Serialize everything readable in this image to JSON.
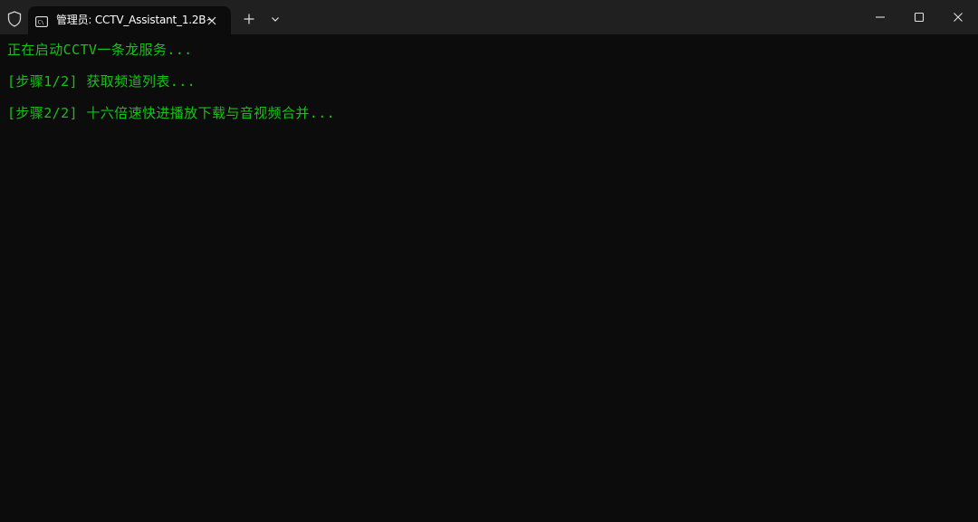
{
  "titlebar": {
    "tab_title": "管理员:  CCTV_Assistant_1.2B~",
    "icons": {
      "shield": "shield-icon",
      "terminal": "terminal-icon",
      "tab_close": "close-icon",
      "new_tab": "plus-icon",
      "dropdown": "chevron-down-icon",
      "minimize": "minimize-icon",
      "maximize": "maximize-icon",
      "close": "close-icon"
    }
  },
  "console": {
    "lines": [
      "正在启动CCTV一条龙服务...",
      "[步骤1/2] 获取频道列表...",
      "[步骤2/2] 十六倍速快进播放下载与音视频合并..."
    ]
  },
  "colors": {
    "titlebar_bg": "#202020",
    "console_bg": "#0c0c0c",
    "text_green": "#15c315",
    "tab_text": "#ffffff"
  }
}
